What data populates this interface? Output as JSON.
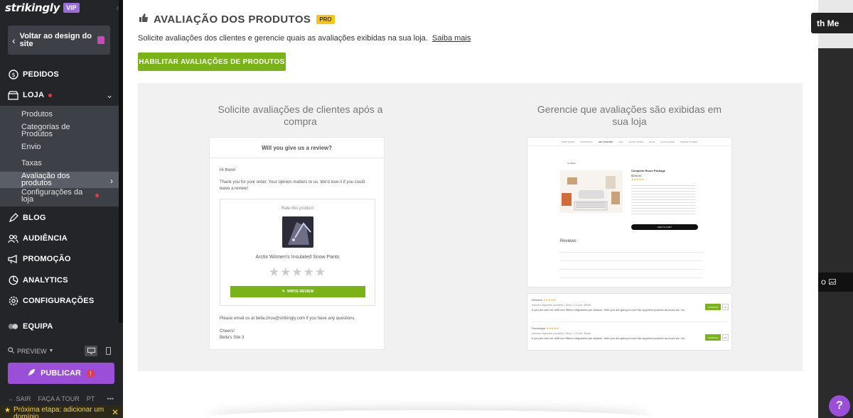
{
  "sidebar": {
    "logo": "strikingly",
    "vip_badge": "VIP",
    "back_button": "Voltar ao design do site",
    "nav": {
      "pedidos": "PEDIDOS",
      "loja": "LOJA",
      "blog": "BLOG",
      "audiencia": "AUDIÊNCIA",
      "promocao": "PROMOÇÃO",
      "analytics": "ANALYTICS",
      "configuracoes": "CONFIGURAÇÕES",
      "equipa": "EQUIPA"
    },
    "loja_sub": [
      "Produtos",
      "Categorias de Produtos",
      "Envio",
      "Taxas",
      "Avaliação dos produtos",
      "Configurações da loja"
    ],
    "preview": "PREVIEW",
    "publish": "PUBLICAR",
    "footer": {
      "sair": "SAIR",
      "tour": "FAÇA A TOUR",
      "lang": "PT",
      "more": "•••"
    },
    "next_step": "Próxima etapa: adicionar um domínio"
  },
  "main": {
    "title": "AVALIAÇÃO DOS PRODUTOS",
    "pro_badge": "PRO",
    "description": "Solicite avaliações dos clientes e gerencie quais as avaliações exibidas na sua loja.",
    "learn_more": "Saiba mais",
    "enable_button": "HABILITAR AVALIAÇÕES DE PRODUTOS",
    "left_col_title": "Solicite avaliações de clientes após a compra",
    "right_col_title": "Gerencie que avaliações são exibidas em sua loja",
    "email": {
      "heading": "Will you give us a review?",
      "greeting": "Hi there!",
      "body": "Thank you for your order. Your opinion matters to us. We'd love it if you could leave a review!",
      "rate_label": "Rate this product",
      "product_name": "Arctix Women's Insulated Snow Pants",
      "stars": "★★★★★",
      "write_review": "WRITE REVIEW",
      "contact": "Please email us at bella.zhou@strikingly.com if you have any questions.",
      "signoff": "Cheers!",
      "signature": "Bella's Site 3"
    },
    "shop_preview": {
      "nav": [
        "SHIFT WORK",
        "PORTFOLIO",
        "GET STARTED",
        "FAQ",
        "SHORT SIGNS",
        "BLOG",
        "SOCIAL FEED",
        "SIMPLE STORES"
      ],
      "back": "Go Back",
      "product_title": "Complete Room Package",
      "price": "$296.00",
      "reviews_heading": "Reviews",
      "add_to_cart": "ADD TO CART"
    },
    "review_card": [
      {
        "name": "Wendee",
        "meta": "women zippered pockets | Size L | Color: White",
        "text": "If you are like me and love fifteen chapsticks per season, then you are going to love the zippered pockets as much as I do.",
        "action": "APPROVE"
      },
      {
        "name": "Dominique",
        "meta": "women zippered pockets | Size L | Color: Black",
        "text": "If you are like me and love fifteen chapsticks per season, then you are going to love the zippered pockets as much as I do.",
        "action": "APPROVE"
      }
    ]
  },
  "background": {
    "pill_text": "th Me",
    "help": "?"
  },
  "colors": {
    "accent_green": "#7ab317",
    "publish_purple": "#9b4ed8",
    "pro_yellow": "#f5c518"
  }
}
